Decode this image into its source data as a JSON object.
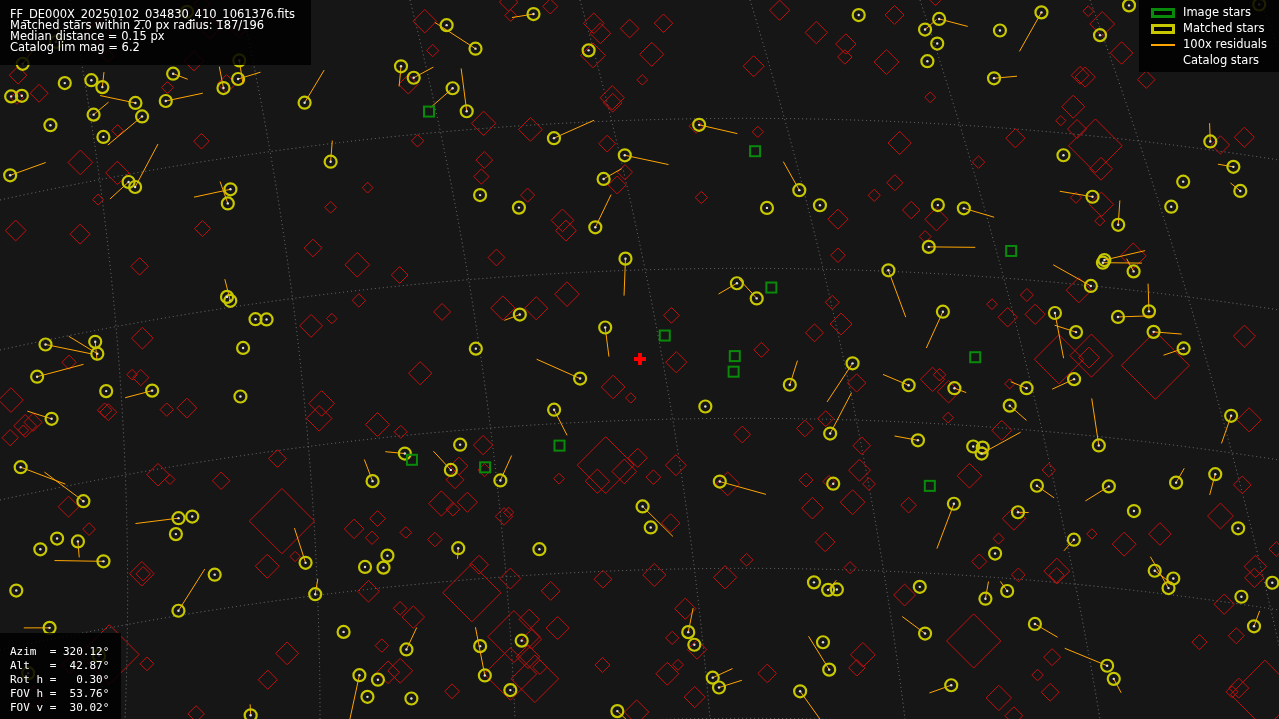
{
  "info_lines": [
    "FF_DE000X_20250102_034830_410_1061376.fits",
    "Matched stars within 2.0 px radius: 187/196",
    "Median distance = 0.15 px",
    "Catalog lim mag = 6.2"
  ],
  "legend": [
    {
      "kind": "box",
      "label": "Image stars",
      "color": "#0a8a0a"
    },
    {
      "kind": "box",
      "label": "Matched stars",
      "color": "#c8c800"
    },
    {
      "kind": "line",
      "label": "100x residuals",
      "color": "#ffa500"
    },
    {
      "kind": "blank",
      "label": "Catalog stars"
    }
  ],
  "pointing_lines": [
    "Azim  = 320.12°",
    "Alt   =  42.87°",
    "Rot h =   0.30°",
    "FOV h =  53.76°",
    "FOV v =  30.02°"
  ]
}
